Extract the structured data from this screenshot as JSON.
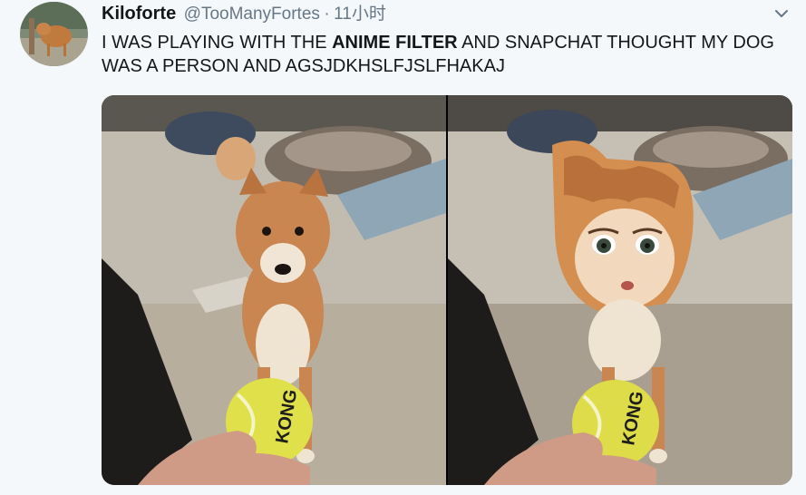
{
  "tweet": {
    "display_name": "Kiloforte",
    "handle": "@TooManyFortes",
    "separator": "·",
    "timestamp": "11小时",
    "text_part1": "I WAS PLAYING WITH THE ",
    "text_bold": "ANIME FILTER",
    "text_part2": " AND SNAPCHAT THOUGHT MY DOG WAS A PERSON AND AGSJDKHSLFJSLFHAKAJ"
  },
  "media": {
    "ball_brand_left": "KONG",
    "ball_brand_right": "KONG"
  },
  "icons": {
    "caret": "chevron-down-icon"
  },
  "colors": {
    "name": "#14171a",
    "secondary": "#657786",
    "background": "#f5f8fa"
  }
}
